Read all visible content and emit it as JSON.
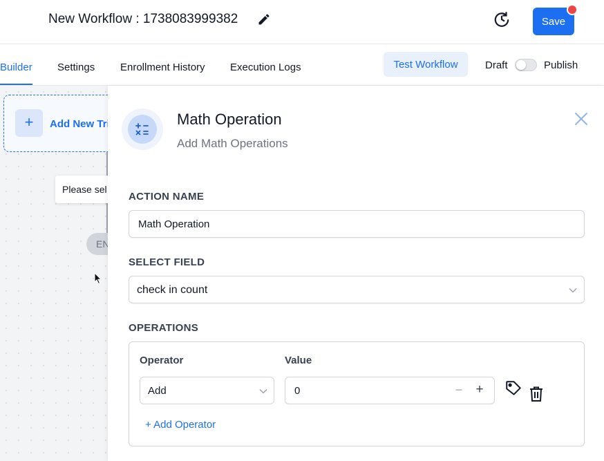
{
  "header": {
    "title": "New Workflow : 1738083999382",
    "save_label": "Save",
    "icons": [
      "pencil-icon",
      "history-icon"
    ]
  },
  "tabs": {
    "items": [
      {
        "label": "Builder",
        "active": true
      },
      {
        "label": "Settings",
        "active": false
      },
      {
        "label": "Enrollment History",
        "active": false
      },
      {
        "label": "Execution Logs",
        "active": false
      }
    ],
    "test_label": "Test Workflow",
    "draft_label": "Draft",
    "publish_label": "Publish",
    "publish_toggle_on": false
  },
  "canvas": {
    "trigger_label": "Add New Tri",
    "tooltip": "Please sel",
    "end_label": "EN"
  },
  "panel": {
    "title": "Math Operation",
    "subtitle": "Add Math Operations",
    "action_name_label": "ACTION NAME",
    "action_name_value": "Math Operation",
    "select_field_label": "SELECT FIELD",
    "select_field_value": "check in count",
    "operations_label": "OPERATIONS",
    "operator_col_label": "Operator",
    "value_col_label": "Value",
    "operator_value": "Add",
    "value_value": "0",
    "add_operator_label": "+ Add Operator"
  },
  "colors": {
    "accent": "#1d6ff2",
    "notification": "#ef4444",
    "canvas_bg": "#f3f4f6"
  }
}
